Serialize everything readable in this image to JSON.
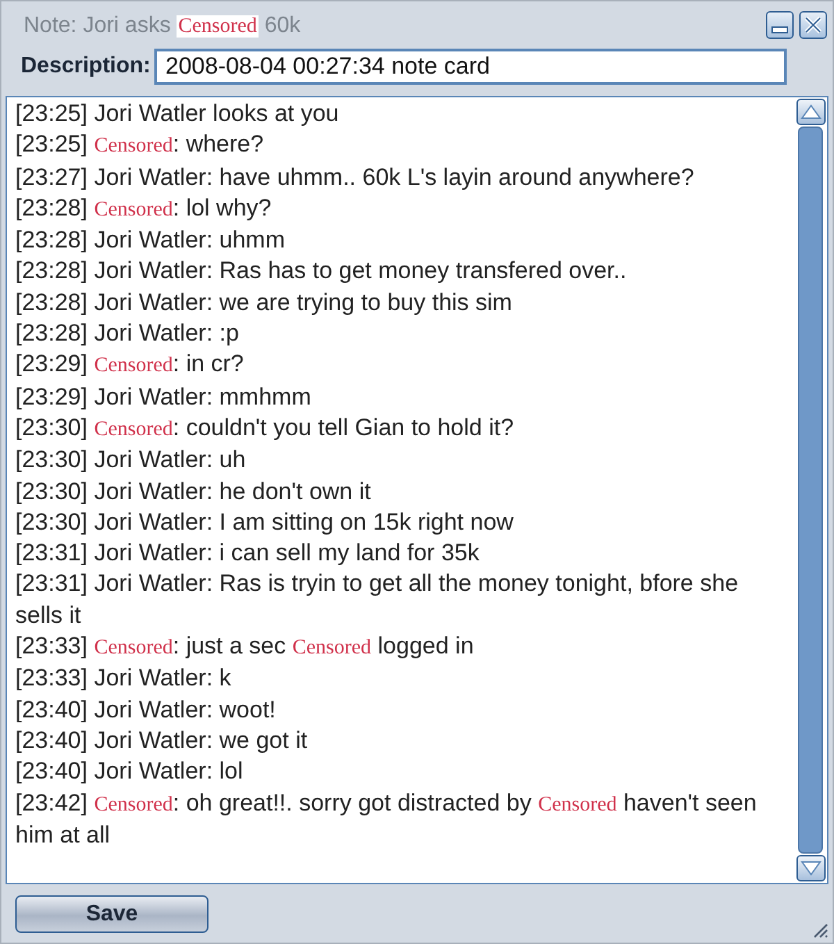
{
  "window": {
    "title": [
      {
        "kind": "text",
        "text": "Note: Jori asks"
      },
      {
        "kind": "censored",
        "text": "Censored"
      },
      {
        "kind": "text",
        "text": "60k"
      }
    ]
  },
  "description": {
    "label": "Description:",
    "value": "2008-08-04 00:27:34 note card"
  },
  "chat": [
    {
      "time": "[23:25]",
      "parts": [
        {
          "kind": "text",
          "text": "Jori Watler looks at you"
        }
      ]
    },
    {
      "time": "[23:25]",
      "parts": [
        {
          "kind": "censored",
          "text": "Censored"
        },
        {
          "kind": "text",
          "text": ": where?"
        }
      ]
    },
    {
      "time": "[23:27]",
      "parts": [
        {
          "kind": "text",
          "text": "Jori Watler: have uhmm.. 60k L's layin around anywhere?"
        }
      ]
    },
    {
      "time": "[23:28]",
      "parts": [
        {
          "kind": "censored",
          "text": "Censored"
        },
        {
          "kind": "text",
          "text": ": lol why?"
        }
      ]
    },
    {
      "time": "[23:28]",
      "parts": [
        {
          "kind": "text",
          "text": "Jori Watler: uhmm"
        }
      ]
    },
    {
      "time": "[23:28]",
      "parts": [
        {
          "kind": "text",
          "text": "Jori Watler: Ras has to get money transfered over.."
        }
      ]
    },
    {
      "time": "[23:28]",
      "parts": [
        {
          "kind": "text",
          "text": "Jori Watler: we are trying to buy this sim"
        }
      ]
    },
    {
      "time": "[23:28]",
      "parts": [
        {
          "kind": "text",
          "text": "Jori Watler: :p"
        }
      ]
    },
    {
      "time": "[23:29]",
      "parts": [
        {
          "kind": "censored",
          "text": "Censored"
        },
        {
          "kind": "text",
          "text": ": in cr?"
        }
      ]
    },
    {
      "time": "[23:29]",
      "parts": [
        {
          "kind": "text",
          "text": "Jori Watler: mmhmm"
        }
      ]
    },
    {
      "time": "[23:30]",
      "parts": [
        {
          "kind": "censored",
          "text": "Censored"
        },
        {
          "kind": "text",
          "text": ": couldn't you tell Gian to hold it?"
        }
      ]
    },
    {
      "time": "[23:30]",
      "parts": [
        {
          "kind": "text",
          "text": "Jori Watler: uh"
        }
      ]
    },
    {
      "time": "[23:30]",
      "parts": [
        {
          "kind": "text",
          "text": "Jori Watler: he don't own it"
        }
      ]
    },
    {
      "time": "[23:30]",
      "parts": [
        {
          "kind": "text",
          "text": "Jori Watler: I am sitting on 15k right now"
        }
      ]
    },
    {
      "time": "[23:31]",
      "parts": [
        {
          "kind": "text",
          "text": "Jori Watler: i can sell my land for 35k"
        }
      ]
    },
    {
      "time": "[23:31]",
      "parts": [
        {
          "kind": "text",
          "text": "Jori Watler: Ras is tryin to get all the money tonight, bfore she sells it"
        }
      ]
    },
    {
      "time": "[23:33]",
      "parts": [
        {
          "kind": "censored",
          "text": "Censored"
        },
        {
          "kind": "text",
          "text": ": just a sec"
        },
        {
          "kind": "censored",
          "text": "Censored"
        },
        {
          "kind": "text",
          "text": "logged in"
        }
      ]
    },
    {
      "time": "[23:33]",
      "parts": [
        {
          "kind": "text",
          "text": "Jori Watler: k"
        }
      ]
    },
    {
      "time": "[23:40]",
      "parts": [
        {
          "kind": "text",
          "text": "Jori Watler: woot!"
        }
      ]
    },
    {
      "time": "[23:40]",
      "parts": [
        {
          "kind": "text",
          "text": "Jori Watler: we got it"
        }
      ]
    },
    {
      "time": "[23:40]",
      "parts": [
        {
          "kind": "text",
          "text": "Jori Watler: lol"
        }
      ]
    },
    {
      "time": "[23:42]",
      "parts": [
        {
          "kind": "censored",
          "text": "Censored"
        },
        {
          "kind": "text",
          "text": ": oh great!!. sorry got distracted by"
        },
        {
          "kind": "censored",
          "text": "Censored"
        },
        {
          "kind": "text",
          "text": "haven't seen him at all"
        }
      ]
    }
  ],
  "buttons": [
    {
      "label": "Save"
    }
  ]
}
